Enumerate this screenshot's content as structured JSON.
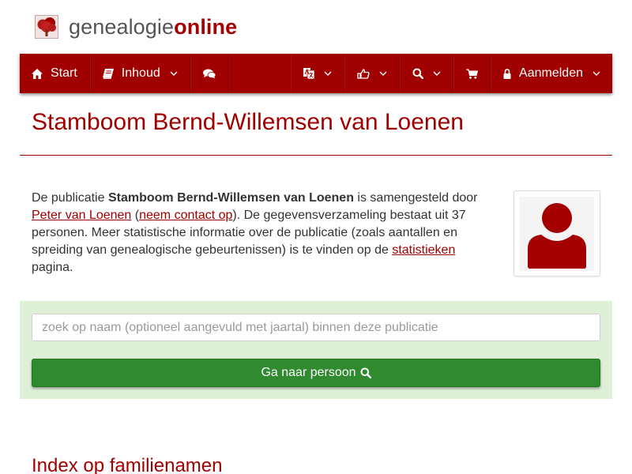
{
  "brand": {
    "name_part1": "genealogie",
    "name_part2": "online",
    "logo_icon": "tree-logo-icon",
    "accent": "#a10000"
  },
  "nav": {
    "start_label": "Start",
    "inhoud_label": "Inhoud",
    "aanmelden_label": "Aanmelden",
    "icons": [
      "home-icon",
      "book-icon",
      "comments-icon",
      "language-icon",
      "thumbs-up-icon",
      "search-icon",
      "cart-icon",
      "lock-icon"
    ]
  },
  "page": {
    "title": "Stamboom Bernd-Willemsen van Loenen"
  },
  "intro": {
    "p1": "De publicatie ",
    "pub_name": "Stamboom Bernd-Willemsen van Loenen",
    "p2": " is samengesteld door ",
    "author": "Peter van Loenen",
    "p3": " (",
    "contact": "neem contact op",
    "p4": "). De gegevensverzameling bestaat uit 37 personen. Meer statistische informatie over de publicatie (zoals aantallen en spreiding van genealogische gebeurtenissen) is te vinden op de ",
    "stats": "statistieken",
    "p5": " pagina."
  },
  "search": {
    "placeholder": "zoek op naam (optioneel aangevuld met jaartal) binnen deze publicatie",
    "button_label": "Ga naar persoon",
    "button_color": "#2f8a30",
    "panel_color": "#dff0d8"
  },
  "index": {
    "title": "Index op familienamen"
  }
}
